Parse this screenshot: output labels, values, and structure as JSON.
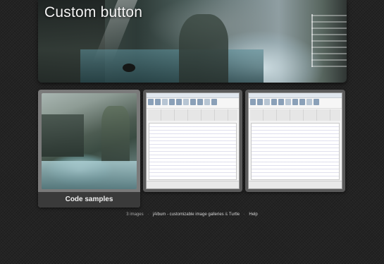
{
  "hero": {
    "title": "Custom button"
  },
  "folder": {
    "label": "Code samples"
  },
  "footer": {
    "count": "3 images",
    "credit_link": "jAlbum - customizable image galleries",
    "ampersand": "&",
    "skin_link": "Turtle",
    "help_link": "Help",
    "separator": "·"
  },
  "icons": {
    "play": "play-icon"
  }
}
